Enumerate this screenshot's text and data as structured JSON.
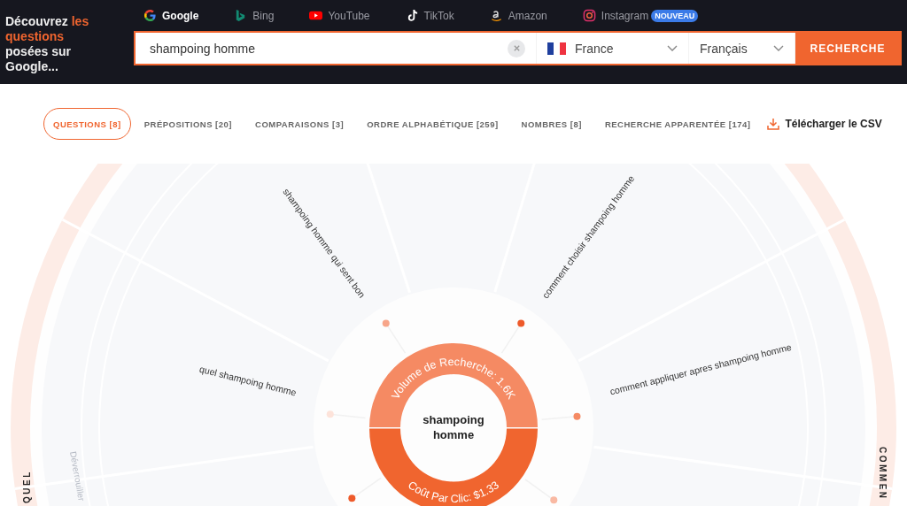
{
  "tagline": {
    "before": "Découvrez",
    "highlight": "les questions",
    "after": "posées sur Google..."
  },
  "engines": [
    {
      "kind": "google",
      "label": "Google",
      "selected": true
    },
    {
      "kind": "bing",
      "label": "Bing",
      "selected": false
    },
    {
      "kind": "youtube",
      "label": "YouTube",
      "selected": false
    },
    {
      "kind": "tiktok",
      "label": "TikTok",
      "selected": false
    },
    {
      "kind": "amazon",
      "label": "Amazon",
      "selected": false
    },
    {
      "kind": "instagram",
      "label": "Instagram",
      "selected": false,
      "badge": "NOUVEAU"
    }
  ],
  "search": {
    "value": "shampoing homme",
    "country": "France",
    "language": "Français",
    "button": "RECHERCHE"
  },
  "tabs": [
    {
      "label": "QUESTIONS [8]",
      "selected": true
    },
    {
      "label": "PRÉPOSITIONS [20]",
      "selected": false
    },
    {
      "label": "COMPARAISONS [3]",
      "selected": false
    },
    {
      "label": "ORDRE ALPHABÉTIQUE [259]",
      "selected": false
    },
    {
      "label": "NOMBRES [8]",
      "selected": false
    },
    {
      "label": "RECHERCHE APPARENTÉE [174]",
      "selected": false
    }
  ],
  "download": "Télécharger le CSV",
  "wheel": {
    "center": "shampoing homme",
    "volume": "Volume de Recherche: 1.6K",
    "cpc": "Coût Par Clic: $1.33",
    "questions": [
      "shampoing homme qui sent bon",
      "comment choisir shampoing homme",
      "quel shampoing homme",
      "comment appliquer apres shampoing homme"
    ],
    "nodes": [
      {
        "color": "#f7a589"
      },
      {
        "color": "#ee5a2a"
      },
      {
        "color": "#fde3da"
      },
      {
        "color": "#f58a63"
      },
      {
        "color": "#ee5a2a"
      },
      {
        "color": "#f9b9a3"
      }
    ],
    "groups": [
      "QUEL",
      "COMMEN"
    ],
    "hint": "Déverrouiller"
  }
}
